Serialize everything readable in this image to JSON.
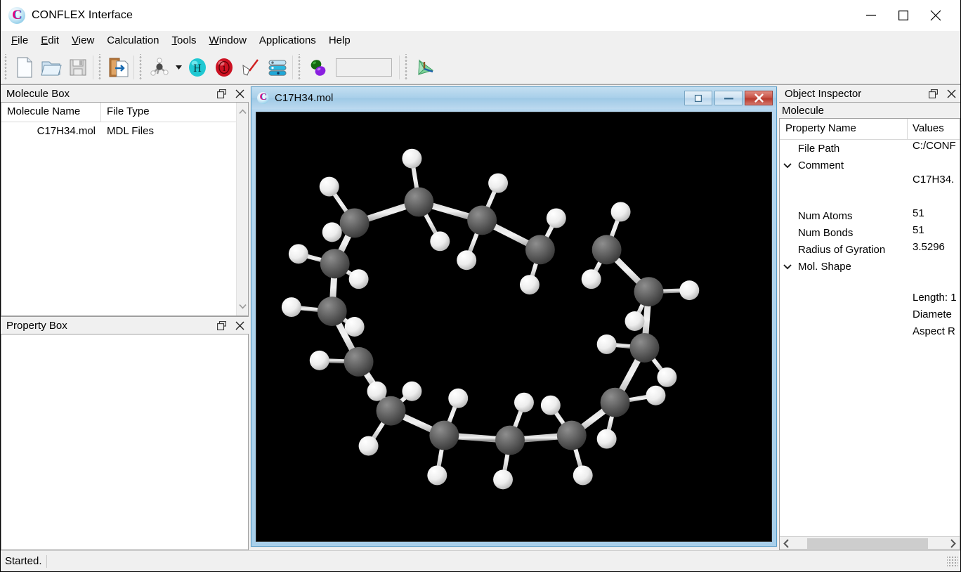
{
  "window": {
    "title": "CONFLEX Interface",
    "logo_icon": "conflex-c-logo",
    "controls": [
      {
        "name": "minimize-button",
        "icon": "minimize-icon"
      },
      {
        "name": "maximize-button",
        "icon": "maximize-icon"
      },
      {
        "name": "close-button",
        "icon": "close-icon"
      }
    ]
  },
  "menubar": {
    "items": [
      {
        "mnemonic": "F",
        "rest": "ile"
      },
      {
        "mnemonic": "E",
        "rest": "dit"
      },
      {
        "mnemonic": "V",
        "rest": "iew"
      },
      {
        "mnemonic": "C",
        "rest": "alculation",
        "no_underline": true
      },
      {
        "mnemonic": "T",
        "rest": "ools"
      },
      {
        "mnemonic": "W",
        "rest": "indow"
      },
      {
        "mnemonic": "A",
        "rest": "pplications",
        "no_underline": true
      },
      {
        "mnemonic": "H",
        "rest": "elp",
        "no_underline": true
      }
    ]
  },
  "toolbar": {
    "buttons": [
      {
        "name": "new-file-button",
        "icon": "new-document-icon"
      },
      {
        "name": "open-file-button",
        "icon": "open-folder-icon"
      },
      {
        "name": "save-file-button",
        "icon": "floppy-save-icon"
      },
      {
        "name": "import-clipboard-button",
        "icon": "import-document-icon"
      },
      {
        "name": "molecule-model-button",
        "icon": "molecule-tetrahedral-icon"
      },
      {
        "name": "add-hydrogen-button",
        "icon": "hydrogen-atom-icon"
      },
      {
        "name": "charge-button",
        "icon": "formal-charge-icon"
      },
      {
        "name": "measure-button",
        "icon": "measure-bond-icon"
      },
      {
        "name": "layers-button",
        "icon": "layers-stack-icon"
      },
      {
        "name": "orbital-button",
        "icon": "orbital-lobes-icon"
      },
      {
        "name": "axes-button",
        "icon": "coordinate-axes-icon"
      }
    ],
    "dropdown_icon": "chevron-down-icon",
    "text_field_value": "",
    "text_field_placeholder": ""
  },
  "molecule_box": {
    "title": "Molecule Box",
    "float_icon": "float-panel-icon",
    "close_icon": "close-icon",
    "columns": [
      "Molecule Name",
      "File Type"
    ],
    "rows": [
      {
        "name": "C17H34.mol",
        "type": "MDL Files"
      }
    ],
    "scroll_up_icon": "chevron-up-icon",
    "scroll_down_icon": "chevron-down-icon"
  },
  "property_box": {
    "title": "Property Box",
    "float_icon": "float-panel-icon",
    "close_icon": "close-icon",
    "content": ""
  },
  "mdi": {
    "title": "C17H34.mol",
    "logo_icon": "conflex-c-logo",
    "restore_icon": "restore-window-icon",
    "minimize_icon": "minimize-icon",
    "close_icon": "close-icon",
    "canvas_background": "#000000",
    "molecule_render": {
      "carbon_color": "#5a5a5a",
      "hydrogen_color": "#f2f2f2",
      "bond_color": "#b8b8b8"
    }
  },
  "object_inspector": {
    "title": "Object Inspector",
    "float_icon": "float-panel-icon",
    "close_icon": "close-icon",
    "subtitle": "Molecule",
    "columns": [
      "Property Name",
      "Values"
    ],
    "rows": [
      {
        "label": "File Path",
        "value": "C:/CONF",
        "expandable": false,
        "indent": true
      },
      {
        "label": "Comment",
        "value": "",
        "expandable": true,
        "expanded": true,
        "indent": false
      },
      {
        "label": "",
        "value": "C17H34.",
        "expandable": false,
        "indent": true
      },
      {
        "label": "",
        "value": "",
        "expandable": false,
        "indent": true
      },
      {
        "label": "Num Atoms",
        "value": "51",
        "expandable": false,
        "indent": true
      },
      {
        "label": "Num Bonds",
        "value": "51",
        "expandable": false,
        "indent": true
      },
      {
        "label": "Radius of Gyration",
        "value": "3.5296",
        "expandable": false,
        "indent": true
      },
      {
        "label": "Mol. Shape",
        "value": "",
        "expandable": true,
        "expanded": true,
        "indent": false
      },
      {
        "label": "",
        "value": "",
        "expandable": false,
        "indent": true
      },
      {
        "label": "",
        "value": "Length: 1",
        "expandable": false,
        "indent": true
      },
      {
        "label": "",
        "value": "Diamete",
        "expandable": false,
        "indent": true
      },
      {
        "label": "",
        "value": "Aspect R",
        "expandable": false,
        "indent": true
      }
    ],
    "expand_icon": "chevron-down-icon",
    "scroll_left_icon": "chevron-left-icon",
    "scroll_right_icon": "chevron-right-icon"
  },
  "statusbar": {
    "message": "Started.",
    "resize_grip_icon": "resize-grip-icon"
  }
}
